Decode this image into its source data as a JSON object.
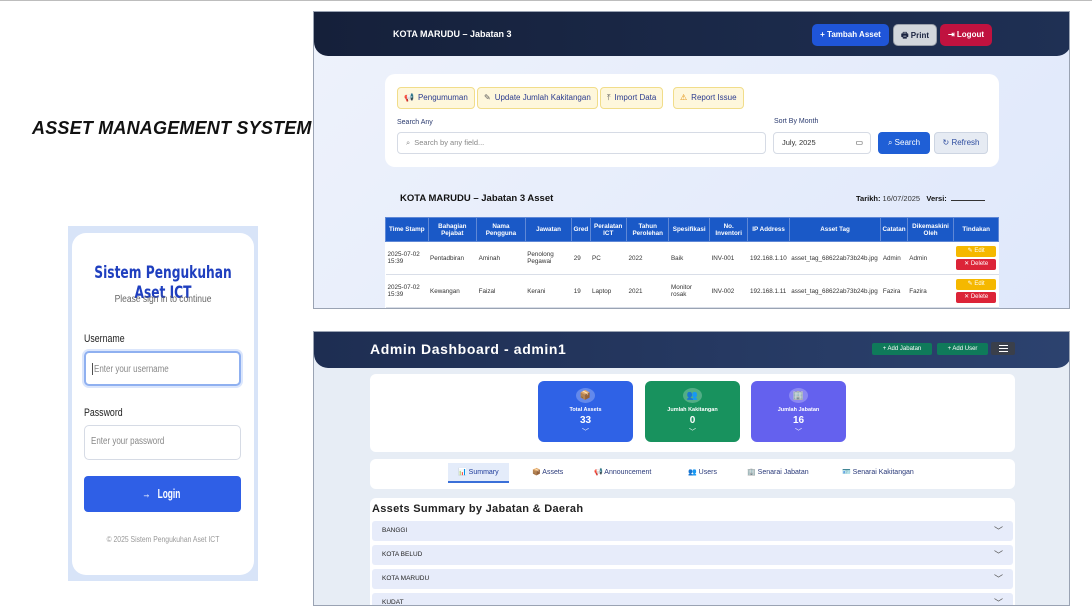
{
  "main_title": "ASSET MANAGEMENT SYSTEM",
  "login": {
    "title": "Sistem Pengukuhan Aset ICT",
    "subtitle": "Please sign in to continue",
    "username_label": "Username",
    "username_placeholder": "Enter your username",
    "password_label": "Password",
    "password_placeholder": "Enter your password",
    "button": "Login",
    "button_icon": "→",
    "footer": "© 2025 Sistem Pengukuhan Aset ICT"
  },
  "jabatan_view": {
    "nav_title": "KOTA MARUDU – Jabatan 3",
    "nav_buttons": [
      {
        "label": "Tambah Asset",
        "icon": "+",
        "color": "#1f55d8"
      },
      {
        "label": "Print",
        "icon": "🖶",
        "color": "#d2d6dc"
      },
      {
        "label": "Logout",
        "icon": "⇥",
        "color": "#c0123f"
      }
    ],
    "toolbar": [
      {
        "label": "Pengumuman",
        "icon": "📢"
      },
      {
        "label": "Update Jumlah Kakitangan",
        "icon": "✎"
      },
      {
        "label": "Import Data",
        "icon": "⤒"
      },
      {
        "label": "Report Issue",
        "icon": "⚠"
      }
    ],
    "search_label": "Search Any",
    "search_placeholder": "Search by any field...",
    "month_label": "Sort By Month",
    "month_value": "July, 2025",
    "search_button": "Search",
    "refresh_button": "Refresh",
    "table_title": "KOTA MARUDU – Jabatan 3 Asset",
    "date_label": "Tarikh:",
    "date_value": "16/07/2025",
    "version_label": "Versi:",
    "columns": [
      "Time Stamp",
      "Bahagian Pejabat",
      "Nama Pengguna",
      "Jawatan",
      "Gred",
      "Peralatan ICT",
      "Tahun Perolehan",
      "Spesifikasi",
      "No. Inventori",
      "IP Address",
      "Asset Tag",
      "Catatan",
      "Dikemaskini Oleh",
      "Tindakan"
    ],
    "rows": [
      [
        "2025-07-02 15:39",
        "Pentadbiran",
        "Aminah",
        "Penolong Pegawai",
        "29",
        "PC",
        "2022",
        "Baik",
        "INV-001",
        "192.168.1.10",
        "asset_tag_68622ab73b24b.jpg",
        "Admin",
        "Admin"
      ],
      [
        "2025-07-02 15:39",
        "Kewangan",
        "Faizal",
        "Kerani",
        "19",
        "Laptop",
        "2021",
        "Monitor rosak",
        "INV-002",
        "192.168.1.11",
        "asset_tag_68622ab73b24b.jpg",
        "Fazira",
        "Fazira"
      ]
    ],
    "edit_label": "Edit",
    "delete_label": "Delete"
  },
  "admin_view": {
    "nav_title": "Admin Dashboard - admin1",
    "nav_buttons": [
      "+ Add Jabatan",
      "+ Add User"
    ],
    "stats": [
      {
        "label": "Total Assets",
        "value": "33",
        "icon": "📦",
        "color": "#2f62e6"
      },
      {
        "label": "Jumlah Kakitangan",
        "value": "0",
        "icon": "👥",
        "color": "#18925e"
      },
      {
        "label": "Jumlah Jabatan",
        "value": "16",
        "icon": "🏢",
        "color": "#6461ee"
      }
    ],
    "tabs": [
      {
        "label": "Summary",
        "icon": "📊"
      },
      {
        "label": "Assets",
        "icon": "📦"
      },
      {
        "label": "Announcement",
        "icon": "📢"
      },
      {
        "label": "Users",
        "icon": "👥"
      },
      {
        "label": "Senarai Jabatan",
        "icon": "🏢"
      },
      {
        "label": "Senarai Kakitangan",
        "icon": "🪪"
      }
    ],
    "summary_title": "Assets Summary by Jabatan & Daerah",
    "districts": [
      "BANGGI",
      "KOTA BELUD",
      "KOTA MARUDU",
      "KUDAT"
    ]
  }
}
